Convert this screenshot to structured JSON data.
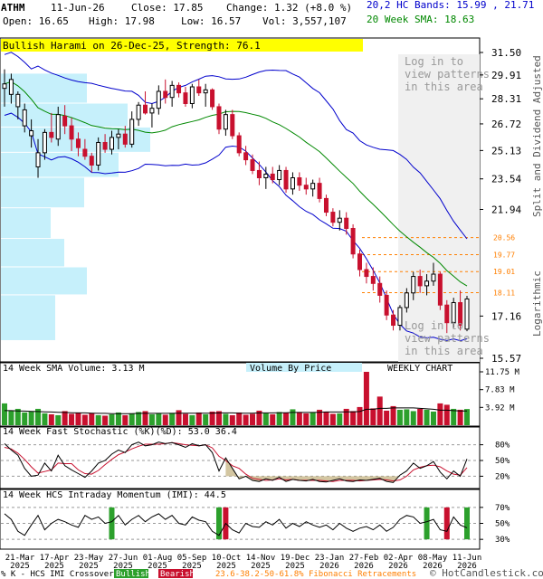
{
  "header": {
    "symbol": "ATHM",
    "date": "11-Jun-26",
    "close_label": "Close: 17.85",
    "change_label": "Change: 1.32 (+8.0 %)",
    "open_label": "Open: 16.65",
    "high_label": "High: 17.98",
    "low_label": "Low: 16.57",
    "vol_label": "Vol: 3,557,107",
    "bands_label": "20,2 HC Bands: 15.99 , 21.71",
    "sma_label": "20 Week SMA: 18.63"
  },
  "pattern_banner": "Bullish Harami on 26-Dec-25, Strength: 76.1",
  "login_text": [
    "Log in to",
    "view patterns",
    "in this area"
  ],
  "side_labels": {
    "adjusted": "Split and Dividend Adjusted",
    "scale": "Logarithmic"
  },
  "panels": {
    "volume_title": "14 Week SMA Volume: 3.13 M",
    "vbp_label": "Volume By Price",
    "weekly_label": "WEEKLY CHART",
    "stoch_title": "14 Week Fast Stochastic (%K)(%D): 53.0  36.4",
    "imi_title": "14 Week HCS Intraday Momentum (IMI): 44.5"
  },
  "footer": {
    "legend_text": "% K - HCS IMI Crossover:",
    "bullish": "Bullish",
    "bearish": "Bearish",
    "fib": "23.6-38.2-50-61.8% Fibonacci Retracements",
    "credit": "© HotCandlestick.com"
  },
  "colors": {
    "bull": "#2ca02c",
    "bear": "#c8102e",
    "band": "#0000cc",
    "sma": "#008800",
    "fib": "#ff7f00",
    "vbp": "#c6f0fb",
    "banner": "#ffff00",
    "login_shade": "#f0f0f0"
  },
  "chart_data": {
    "type": "candlestick",
    "scale": "log",
    "price_axis": {
      "ticks": [
        "31.50",
        "29.91",
        "28.31",
        "26.72",
        "25.13",
        "23.54",
        "21.94",
        "17.16",
        "15.57"
      ],
      "range": [
        15.57,
        31.5
      ]
    },
    "fib_levels": [
      "20.56",
      "19.77",
      "19.01",
      "18.11"
    ],
    "volume_axis": [
      "11.75 M",
      "7.83 M",
      "3.92 M"
    ],
    "stoch_axis": [
      "80%",
      "50%",
      "20%"
    ],
    "imi_axis": [
      "70%",
      "50%",
      "30%"
    ],
    "x_labels": [
      [
        "21-Mar",
        "2025"
      ],
      [
        "17-Apr",
        "2025"
      ],
      [
        "23-May",
        "2025"
      ],
      [
        "27-Jun",
        "2025"
      ],
      [
        "01-Aug",
        "2025"
      ],
      [
        "05-Sep",
        "2025"
      ],
      [
        "10-Oct",
        "2025"
      ],
      [
        "14-Nov",
        "2025"
      ],
      [
        "19-Dec",
        "2025"
      ],
      [
        "23-Jan",
        "2026"
      ],
      [
        "27-Feb",
        "2026"
      ],
      [
        "02-Apr",
        "2026"
      ],
      [
        "08-May",
        "2026"
      ],
      [
        "11-Jun",
        "2026"
      ]
    ],
    "candles": [
      [
        29.0,
        30.3,
        27.8,
        29.3
      ],
      [
        28.6,
        30.0,
        28.0,
        29.6
      ],
      [
        27.8,
        28.8,
        27.0,
        28.6
      ],
      [
        26.6,
        28.0,
        26.2,
        27.6
      ],
      [
        26.0,
        27.0,
        25.3,
        26.3
      ],
      [
        24.2,
        25.8,
        23.6,
        25.0
      ],
      [
        25.0,
        26.4,
        24.6,
        26.2
      ],
      [
        26.2,
        27.4,
        25.6,
        25.9
      ],
      [
        25.8,
        27.8,
        25.4,
        27.3
      ],
      [
        27.2,
        27.9,
        26.1,
        26.6
      ],
      [
        26.6,
        27.1,
        25.1,
        25.8
      ],
      [
        25.8,
        26.2,
        24.8,
        25.3
      ],
      [
        25.2,
        25.8,
        24.6,
        24.8
      ],
      [
        24.8,
        25.0,
        23.9,
        24.3
      ],
      [
        24.3,
        25.9,
        24.0,
        25.6
      ],
      [
        25.6,
        26.1,
        25.0,
        25.2
      ],
      [
        25.2,
        26.3,
        24.9,
        25.9
      ],
      [
        25.9,
        26.4,
        25.2,
        26.1
      ],
      [
        26.1,
        26.6,
        25.3,
        25.5
      ],
      [
        25.5,
        27.5,
        25.3,
        27.0
      ],
      [
        27.0,
        28.1,
        26.6,
        27.9
      ],
      [
        27.9,
        28.8,
        27.3,
        27.4
      ],
      [
        27.4,
        28.0,
        26.5,
        27.7
      ],
      [
        27.7,
        29.2,
        27.3,
        28.8
      ],
      [
        28.8,
        29.6,
        28.0,
        28.4
      ],
      [
        28.4,
        29.5,
        27.8,
        29.2
      ],
      [
        29.2,
        29.4,
        28.4,
        28.7
      ],
      [
        28.7,
        29.1,
        27.8,
        28.0
      ],
      [
        28.0,
        29.3,
        27.7,
        29.1
      ],
      [
        29.1,
        29.6,
        28.5,
        28.7
      ],
      [
        28.7,
        29.3,
        27.8,
        28.9
      ],
      [
        28.9,
        29.0,
        27.6,
        27.8
      ],
      [
        27.8,
        28.0,
        26.1,
        26.4
      ],
      [
        26.4,
        27.6,
        26.0,
        27.3
      ],
      [
        27.3,
        27.6,
        25.8,
        26.0
      ],
      [
        26.0,
        26.2,
        24.8,
        25.0
      ],
      [
        25.0,
        25.4,
        24.3,
        24.6
      ],
      [
        24.6,
        24.9,
        23.8,
        24.0
      ],
      [
        24.0,
        24.5,
        23.2,
        23.6
      ],
      [
        23.6,
        24.2,
        23.0,
        23.8
      ],
      [
        23.8,
        24.2,
        23.3,
        23.5
      ],
      [
        23.5,
        24.3,
        23.2,
        24.0
      ],
      [
        24.0,
        24.2,
        22.8,
        23.0
      ],
      [
        23.0,
        23.9,
        22.7,
        23.6
      ],
      [
        23.6,
        23.9,
        22.9,
        23.2
      ],
      [
        23.2,
        23.6,
        22.7,
        23.0
      ],
      [
        23.0,
        23.5,
        22.6,
        23.3
      ],
      [
        23.3,
        23.6,
        22.3,
        22.5
      ],
      [
        22.5,
        22.7,
        21.6,
        21.8
      ],
      [
        21.8,
        22.0,
        21.1,
        21.3
      ],
      [
        21.3,
        21.9,
        20.9,
        21.5
      ],
      [
        21.5,
        21.8,
        20.7,
        21.0
      ],
      [
        21.0,
        21.2,
        19.6,
        19.8
      ],
      [
        19.8,
        20.0,
        18.8,
        19.1
      ],
      [
        19.1,
        19.4,
        18.5,
        18.8
      ],
      [
        18.8,
        19.2,
        18.2,
        18.5
      ],
      [
        18.5,
        18.8,
        17.7,
        18.0
      ],
      [
        18.0,
        18.2,
        17.0,
        17.2
      ],
      [
        17.2,
        17.4,
        16.6,
        16.8
      ],
      [
        16.8,
        17.6,
        16.6,
        17.5
      ],
      [
        17.5,
        18.3,
        17.3,
        18.1
      ],
      [
        18.1,
        19.0,
        17.8,
        18.8
      ],
      [
        18.8,
        19.1,
        18.1,
        18.4
      ],
      [
        18.4,
        18.9,
        18.0,
        18.6
      ],
      [
        18.6,
        19.4,
        18.4,
        18.9
      ],
      [
        18.9,
        19.0,
        17.4,
        17.6
      ],
      [
        17.6,
        17.8,
        16.5,
        16.9
      ],
      [
        16.9,
        17.9,
        16.7,
        17.7
      ],
      [
        17.7,
        18.2,
        16.6,
        16.8
      ],
      [
        16.65,
        17.98,
        16.57,
        17.85
      ]
    ],
    "volume": [
      4.8,
      3.2,
      3.6,
      2.8,
      3.0,
      3.6,
      2.6,
      2.4,
      2.2,
      3.1,
      2.5,
      2.7,
      2.3,
      2.6,
      2.2,
      2.1,
      2.4,
      2.8,
      2.2,
      2.6,
      2.9,
      3.1,
      2.4,
      2.6,
      2.3,
      2.7,
      3.3,
      2.5,
      2.2,
      2.8,
      2.4,
      3.0,
      3.1,
      2.5,
      2.2,
      2.8,
      2.3,
      2.5,
      3.2,
      2.6,
      2.4,
      2.9,
      2.7,
      3.5,
      2.9,
      2.6,
      2.8,
      3.4,
      3.0,
      2.5,
      2.6,
      3.6,
      3.1,
      4.0,
      11.75,
      3.7,
      6.3,
      3.2,
      4.2,
      3.4,
      3.5,
      3.1,
      3.6,
      3.4,
      3.0,
      4.8,
      4.5,
      3.6,
      3.4,
      3.56
    ],
    "vol_sma": [
      3.2,
      3.2,
      3.15,
      3.1,
      3.05,
      3.0,
      2.95,
      2.9,
      2.85,
      2.8,
      2.75,
      2.7,
      2.7,
      2.65,
      2.6,
      2.6,
      2.55,
      2.55,
      2.55,
      2.55,
      2.6,
      2.6,
      2.6,
      2.6,
      2.6,
      2.6,
      2.65,
      2.65,
      2.65,
      2.65,
      2.65,
      2.65,
      2.7,
      2.7,
      2.7,
      2.65,
      2.65,
      2.65,
      2.7,
      2.7,
      2.7,
      2.75,
      2.75,
      2.8,
      2.8,
      2.8,
      2.8,
      2.85,
      2.9,
      2.9,
      2.9,
      2.95,
      2.95,
      3.0,
      3.5,
      3.5,
      3.7,
      3.7,
      3.8,
      3.8,
      3.8,
      3.8,
      3.7,
      3.6,
      3.5,
      3.3,
      3.3,
      3.2,
      3.15,
      3.13
    ],
    "stoch_k": [
      82,
      70,
      60,
      35,
      20,
      22,
      45,
      30,
      60,
      40,
      32,
      25,
      18,
      30,
      45,
      50,
      62,
      70,
      65,
      80,
      85,
      78,
      80,
      85,
      82,
      84,
      80,
      75,
      82,
      78,
      80,
      65,
      30,
      55,
      35,
      15,
      20,
      12,
      10,
      15,
      12,
      18,
      10,
      14,
      12,
      11,
      14,
      10,
      9,
      12,
      15,
      11,
      10,
      13,
      12,
      14,
      16,
      10,
      8,
      22,
      30,
      45,
      35,
      40,
      48,
      28,
      15,
      30,
      20,
      53
    ],
    "stoch_d": [
      75,
      72,
      64,
      52,
      38,
      26,
      29,
      32,
      45,
      44,
      44,
      32,
      25,
      24,
      31,
      42,
      52,
      61,
      66,
      72,
      77,
      81,
      81,
      81,
      82,
      84,
      82,
      80,
      79,
      78,
      80,
      74,
      58,
      50,
      40,
      35,
      24,
      16,
      14,
      12,
      13,
      15,
      13,
      14,
      12,
      12,
      12,
      12,
      11,
      10,
      12,
      12,
      12,
      11,
      12,
      13,
      14,
      13,
      11,
      13,
      20,
      32,
      37,
      40,
      41,
      38,
      30,
      24,
      22,
      36.4
    ],
    "imi": [
      62,
      55,
      40,
      35,
      48,
      60,
      42,
      50,
      55,
      52,
      48,
      45,
      60,
      55,
      58,
      50,
      52,
      60,
      48,
      55,
      60,
      52,
      58,
      62,
      55,
      60,
      50,
      48,
      58,
      54,
      52,
      40,
      35,
      50,
      42,
      38,
      50,
      46,
      45,
      52,
      48,
      55,
      44,
      50,
      46,
      52,
      48,
      45,
      48,
      42,
      50,
      44,
      40,
      44,
      46,
      42,
      48,
      40,
      45,
      55,
      60,
      58,
      50,
      52,
      55,
      42,
      40,
      58,
      48,
      44.5
    ],
    "xo_bull": [
      18,
      65,
      69
    ],
    "xo_bear": [
      1,
      32,
      33,
      67
    ],
    "xo_bull_imi": [
      16,
      32,
      63,
      69
    ],
    "xo_bear_imi": [
      33,
      66
    ]
  }
}
